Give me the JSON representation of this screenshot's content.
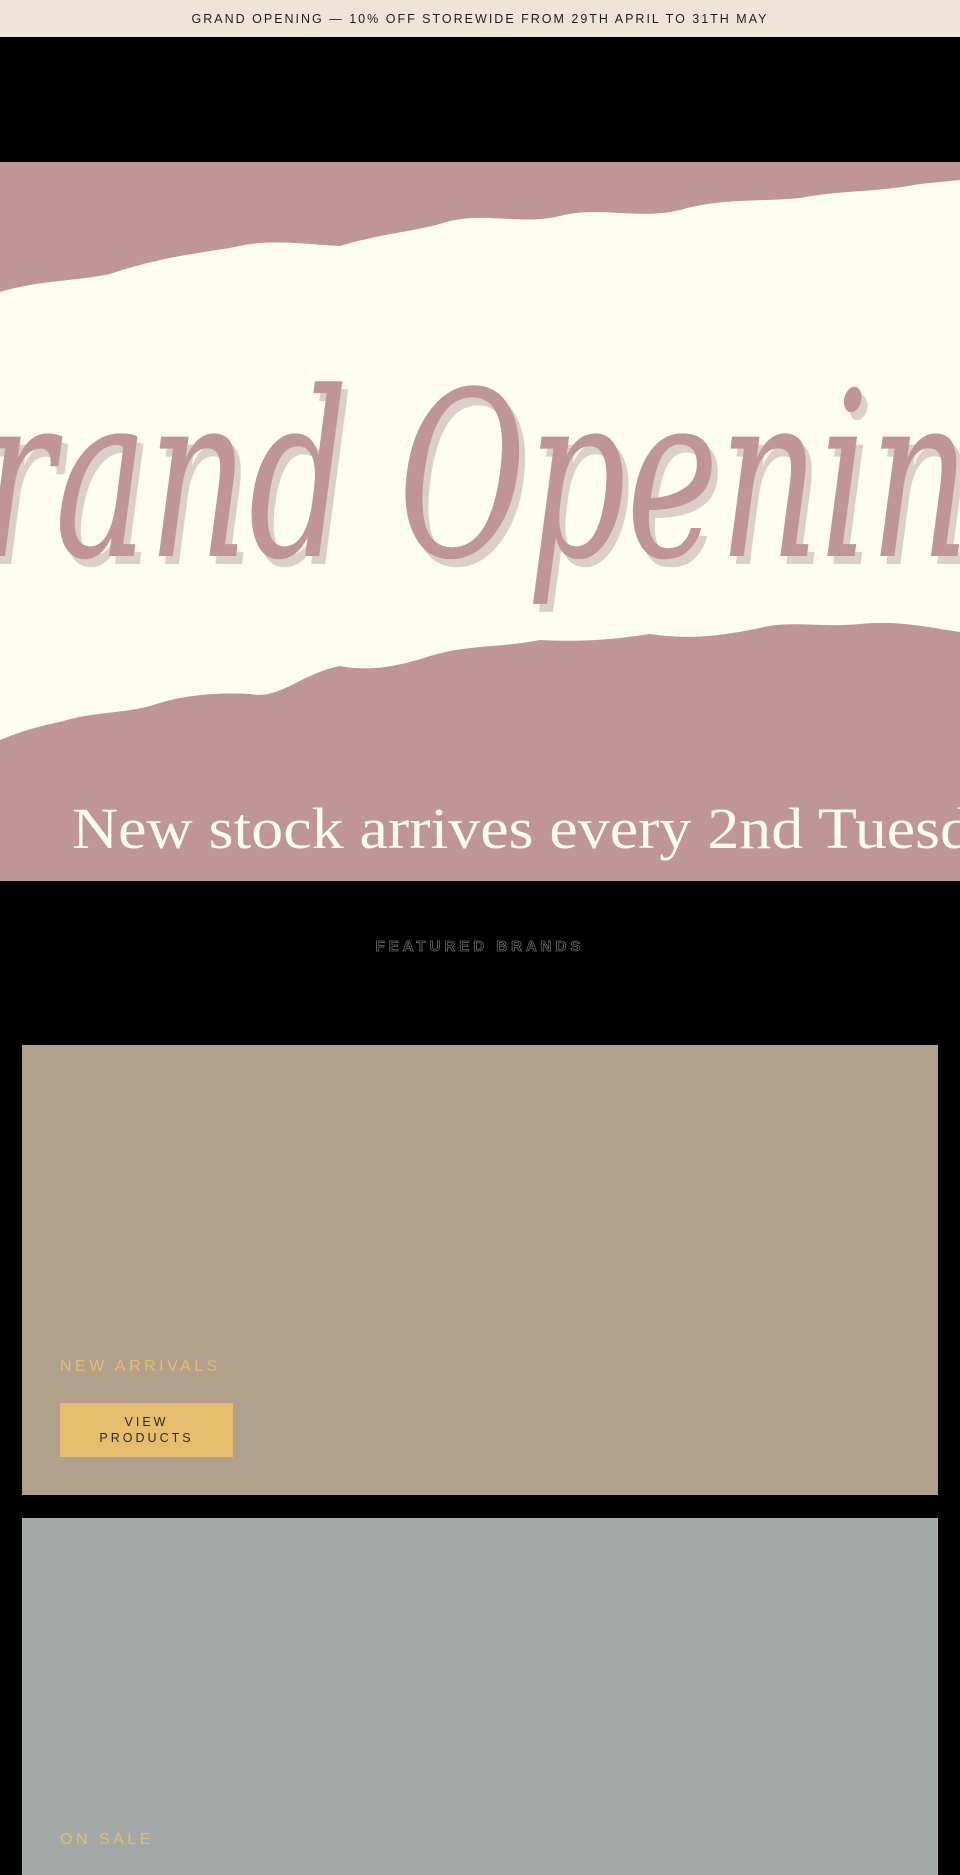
{
  "announcement": {
    "text": "GRAND OPENING — 10% OFF STOREWIDE FROM 29TH APRIL TO 31TH MAY"
  },
  "hero": {
    "script_text": "rand Openin",
    "tagline": "New stock arrives every 2nd Tuesd",
    "colors": {
      "background": "#c09598",
      "paper": "#fdfdf1",
      "script": "#c09598",
      "shadow": "#dccfcb"
    }
  },
  "featured": {
    "heading": "FEATURED BRANDS"
  },
  "collections": [
    {
      "heading": "NEW ARRIVALS",
      "button_label": "VIEW PRODUCTS",
      "background": "#b1a18c"
    },
    {
      "heading": "ON SALE",
      "background": "#a4a8a7"
    }
  ],
  "colors": {
    "accent": "#e6bd6d",
    "page": "#000000",
    "announcement_bg": "#f0e4d9"
  }
}
